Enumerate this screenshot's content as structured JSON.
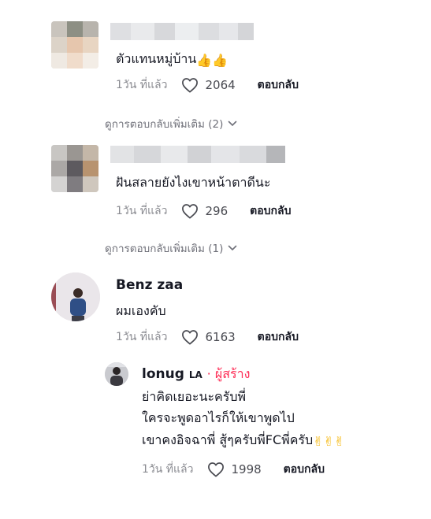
{
  "comments": [
    {
      "text": "ตัวแทนหมู่บ้าน",
      "emoji": "👍👍",
      "time": "1วัน ที่แล้ว",
      "likes": "2064",
      "reply_label": "ตอบกลับ",
      "view_more": "ดูการตอบกลับเพิ่มเติม (2)"
    },
    {
      "text": "ฝันสลายยังไงเขาหน้าตาดีนะ",
      "time": "1วัน ที่แล้ว",
      "likes": "296",
      "reply_label": "ตอบกลับ",
      "view_more": "ดูการตอบกลับเพิ่มเติม (1)"
    },
    {
      "username": "Benz zaa",
      "text": "ผมเองคับ",
      "time": "1วัน ที่แล้ว",
      "likes": "6163",
      "reply_label": "ตอบกลับ"
    }
  ],
  "reply": {
    "username": "lonug",
    "tag": "LA",
    "creator_label": "· ผู้สร้าง",
    "lines": [
      "ย่าคิดเยอะนะครับพี่",
      "ใครจะพูดอาไรก็ให้เขาพูดไป",
      "เขาคงอิจฉาพี่ สู้ๆครับพี่FCพี่ครับ"
    ],
    "emoji": "✌✌✌",
    "time": "1วัน ที่แล้ว",
    "likes": "1998",
    "reply_label": "ตอบกลับ"
  },
  "colors": {
    "text": "#161823",
    "muted": "#8a8b91",
    "creator": "#fe2c55",
    "emoji": "#f5b400"
  },
  "icons": {
    "like": "heart-outline-icon",
    "expand": "chevron-down-icon"
  }
}
